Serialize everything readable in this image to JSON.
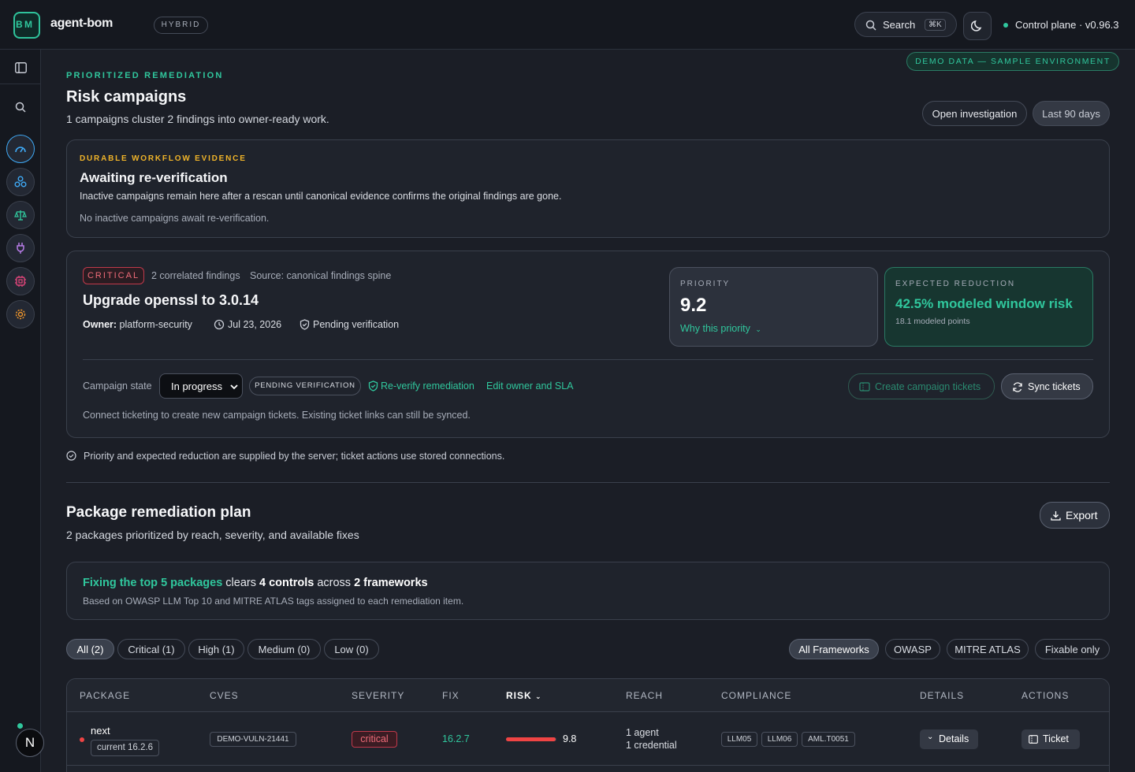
{
  "topbar": {
    "logo_mark": "B M",
    "app_name": "agent-bom",
    "mode_badge": "HYBRID",
    "search_label": "Search",
    "search_shortcut": "⌘K",
    "status_text": "Control plane · v0.96.3",
    "status_color": "#30c79d"
  },
  "demo_banner": "DEMO DATA — SAMPLE ENVIRONMENT",
  "sidebar": {
    "items": [
      {
        "icon": "gauge-icon",
        "color": "#3fa9f5"
      },
      {
        "icon": "cluster-icon",
        "color": "#3fa9f5"
      },
      {
        "icon": "scale-icon",
        "color": "#30c79d"
      },
      {
        "icon": "plug-icon",
        "color": "#b77ce8"
      },
      {
        "icon": "chip-icon",
        "color": "#e0457b"
      },
      {
        "icon": "gear-icon",
        "color": "#f0962b"
      }
    ],
    "user_initial": "N"
  },
  "header": {
    "eyebrow": "PRIORITIZED REMEDIATION",
    "title": "Risk campaigns",
    "subtitle": "1 campaigns cluster 2 findings into owner-ready work.",
    "open_investigation": "Open investigation",
    "range_label": "Last 90 days"
  },
  "evidence": {
    "eyebrow": "DURABLE WORKFLOW EVIDENCE",
    "title": "Awaiting re-verification",
    "description": "Inactive campaigns remain here after a rescan until canonical evidence confirms the original findings are gone.",
    "empty_text": "No inactive campaigns await re-verification."
  },
  "campaign": {
    "severity": "CRITICAL",
    "findings_count": "2 correlated findings",
    "source": "Source: canonical findings spine",
    "title": "Upgrade openssl to 3.0.14",
    "owner_label": "Owner:",
    "owner": "platform-security",
    "due_date": "Jul 23, 2026",
    "verification": "Pending verification",
    "priority_label": "PRIORITY",
    "priority_value": "9.2",
    "priority_link": "Why this priority",
    "reduction_label": "EXPECTED REDUCTION",
    "reduction_value": "42.5% modeled window risk",
    "reduction_points": "18.1 modeled points",
    "state_label": "Campaign state",
    "state_selected": "In progress",
    "state_badge": "PENDING VERIFICATION",
    "reverify_link": "Re-verify remediation",
    "edit_link": "Edit owner and SLA",
    "create_tickets": "Create campaign tickets",
    "sync_tickets": "Sync tickets",
    "ticket_note": "Connect ticketing to create new campaign tickets. Existing ticket links can still be synced."
  },
  "server_note": "Priority and expected reduction are supplied by the server; ticket actions use stored connections.",
  "plan": {
    "title": "Package remediation plan",
    "subtitle": "2 packages prioritized by reach, severity, and available fixes",
    "export_label": "Export",
    "summary_highlight": "Fixing the top 5 packages",
    "summary_mid1": " clears ",
    "summary_controls": "4 controls",
    "summary_mid2": " across ",
    "summary_frameworks": "2 frameworks",
    "summary_note": "Based on OWASP LLM Top 10 and MITRE ATLAS tags assigned to each remediation item.",
    "severity_filters": [
      "All (2)",
      "Critical (1)",
      "High (1)",
      "Medium (0)",
      "Low (0)"
    ],
    "framework_filters": [
      "All Frameworks",
      "OWASP",
      "MITRE ATLAS",
      "Fixable only"
    ]
  },
  "table": {
    "headers": {
      "package": "PACKAGE",
      "cves": "CVES",
      "severity": "SEVERITY",
      "fix": "FIX",
      "risk": "RISK",
      "reach": "REACH",
      "compliance": "COMPLIANCE",
      "details": "DETAILS",
      "actions": "ACTIONS"
    },
    "rows": [
      {
        "package": "next",
        "current": "current 16.2.6",
        "cve": "DEMO-VULN-21441",
        "severity": "critical",
        "fix": "16.2.7",
        "risk": "9.8",
        "risk_fraction": 0.98,
        "reach_agents": "1 agent",
        "reach_credentials": "1 credential",
        "compliance": [
          "LLM05",
          "LLM06",
          "AML.T0051"
        ],
        "details_label": "Details",
        "ticket_label": "Ticket"
      }
    ]
  }
}
